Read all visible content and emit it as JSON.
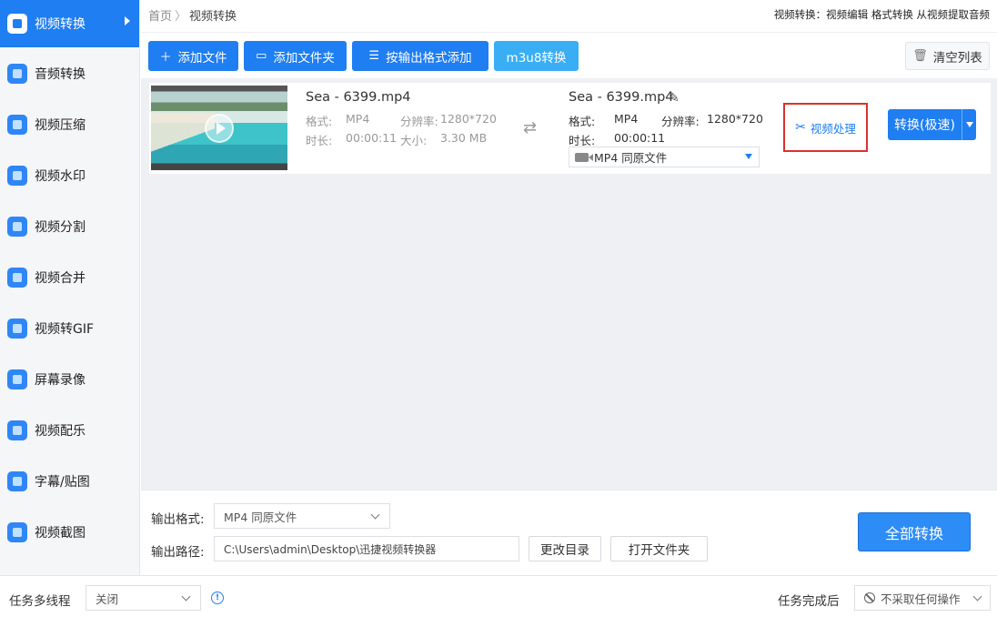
{
  "sidebar": {
    "items": [
      {
        "label": "视频转换",
        "active": true
      },
      {
        "label": "音频转换"
      },
      {
        "label": "视频压缩"
      },
      {
        "label": "视频水印"
      },
      {
        "label": "视频分割"
      },
      {
        "label": "视频合并"
      },
      {
        "label": "视频转GIF"
      },
      {
        "label": "屏幕录像"
      },
      {
        "label": "视频配乐"
      },
      {
        "label": "字幕/贴图"
      },
      {
        "label": "视频截图"
      }
    ]
  },
  "breadcrumb": {
    "home": "首页",
    "separator": "〉",
    "current": "视频转换"
  },
  "header": {
    "right_text": "视频转换：视频编辑 格式转换 从视频提取音频"
  },
  "toolbar": {
    "add_file": "添加文件",
    "add_folder": "添加文件夹",
    "add_by_format": "按输出格式添加",
    "m3u8": "m3u8转换",
    "clear_list": "清空列表"
  },
  "file": {
    "source": {
      "name": "Sea - 6399.mp4",
      "format_label": "格式:",
      "format": "MP4",
      "resolution_label": "分辨率:",
      "resolution": "1280*720",
      "duration_label": "时长:",
      "duration": "00:00:11",
      "size_label": "大小:",
      "size": "3.30 MB"
    },
    "target": {
      "name": "Sea - 6399.mp4",
      "format_label": "格式:",
      "format": "MP4",
      "resolution_label": "分辨率:",
      "resolution": "1280*720",
      "duration_label": "时长:",
      "duration": "00:00:11",
      "output_format": "MP4  同原文件"
    },
    "video_process": "视频处理",
    "convert_button": "转换(极速)"
  },
  "output": {
    "format_label": "输出格式:",
    "format_value": "MP4  同原文件",
    "path_label": "输出路径:",
    "path_value": "C:\\Users\\admin\\Desktop\\迅捷视频转换器",
    "change_dir": "更改目录",
    "open_folder": "打开文件夹",
    "convert_all": "全部转换"
  },
  "bottom": {
    "multithread_label": "任务多线程",
    "multithread_value": "关闭",
    "info_icon": "!",
    "after_label": "任务完成后",
    "after_value": "不采取任何操作"
  },
  "colors": {
    "accent": "#1f7ef1",
    "highlight_border": "#d9322e"
  }
}
